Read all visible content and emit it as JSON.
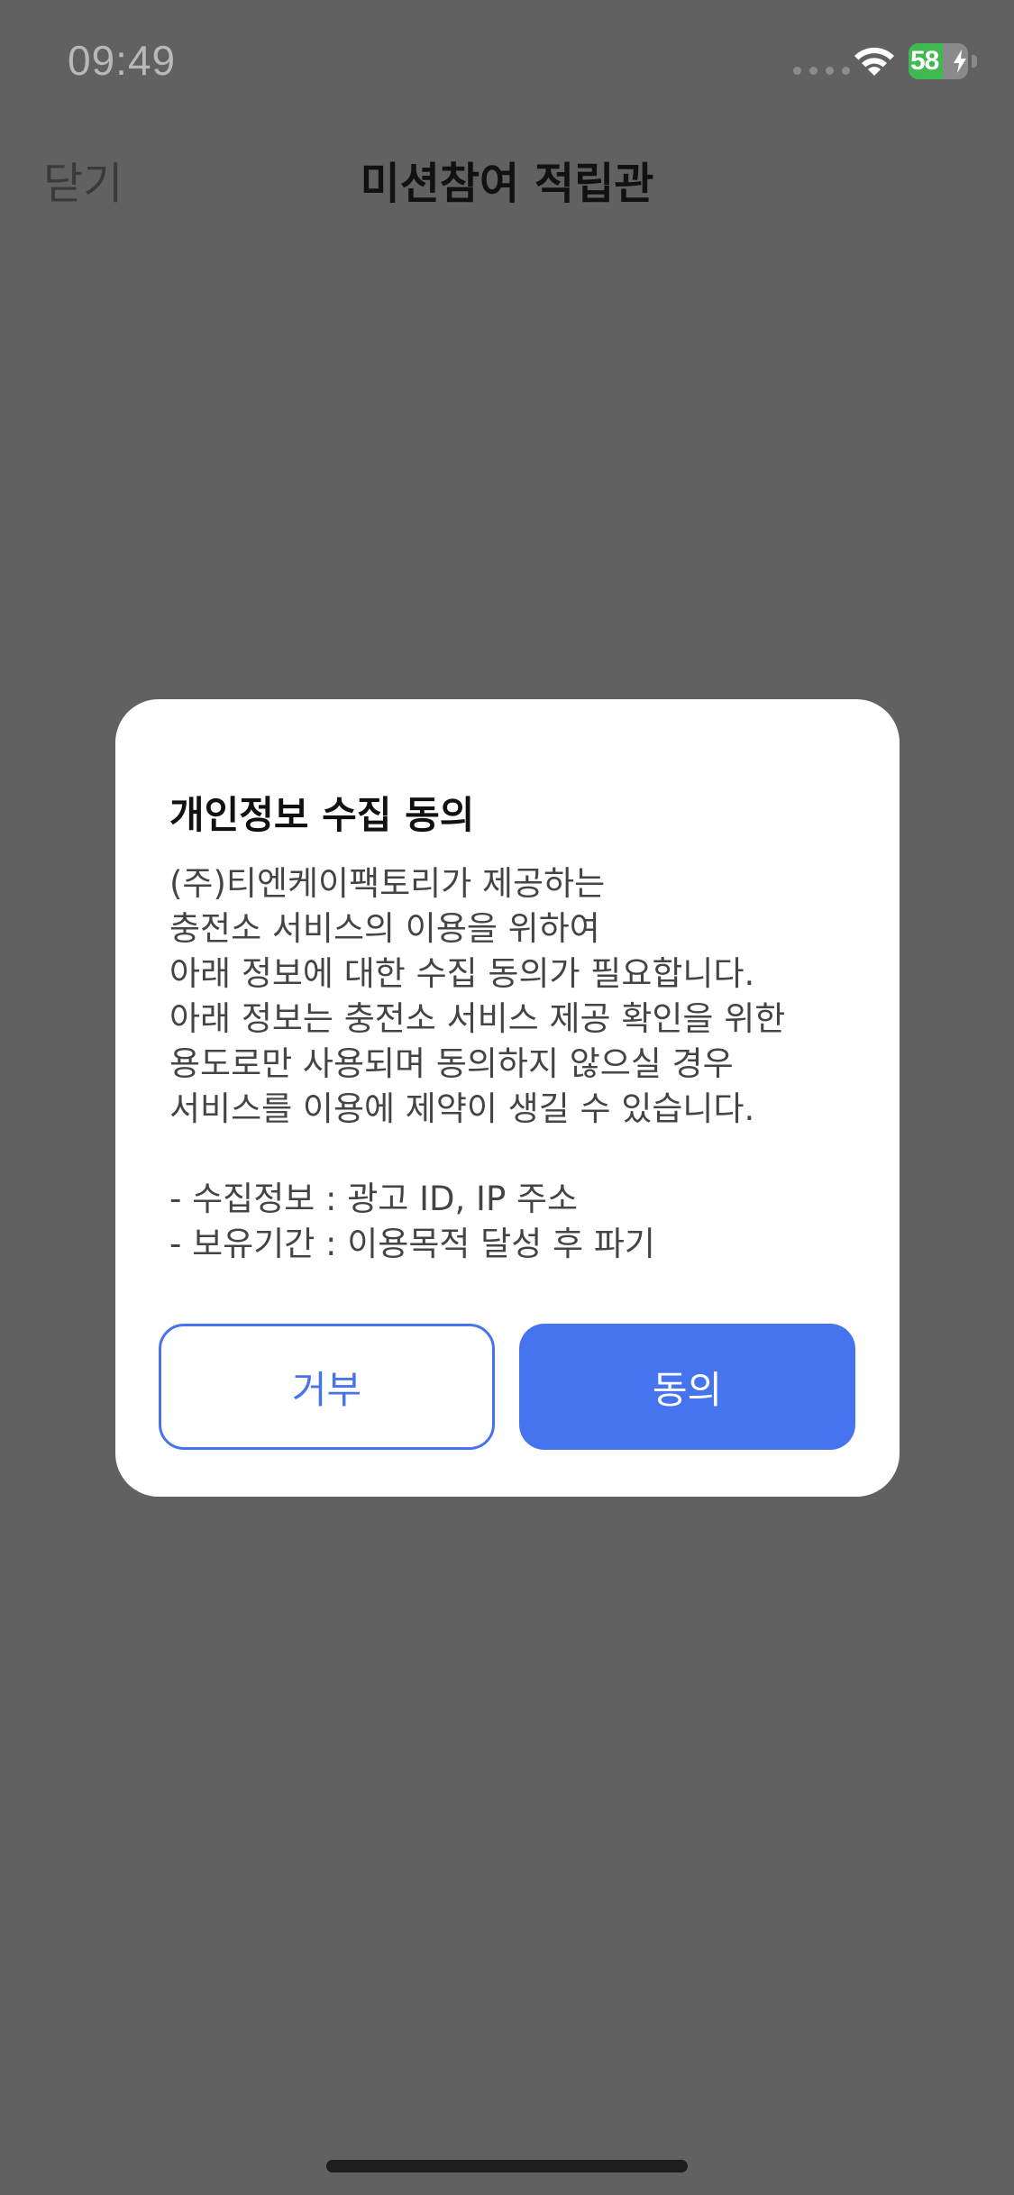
{
  "status_bar": {
    "time": "09:49",
    "battery_label": "58",
    "battery_level_percent": 58,
    "battery_color": "#3fb950",
    "icons": [
      "cellular-dots-icon",
      "wifi-icon",
      "battery-icon",
      "charging-bolt-icon"
    ]
  },
  "nav": {
    "close_label": "닫기",
    "title": "미션참여 적립관"
  },
  "modal": {
    "title": "개인정보 수집 동의",
    "body_lines": [
      "(주)티엔케이팩토리가 제공하는",
      "충전소 서비스의 이용을 위하여",
      "아래 정보에 대한 수집 동의가 필요합니다.",
      "아래 정보는 충전소 서비스 제공 확인을 위한",
      "용도로만 사용되며 동의하지 않으실 경우",
      "서비스를 이용에 제약이 생길 수 있습니다.",
      "",
      "- 수집정보 : 광고 ID, IP 주소",
      "- 보유기간 : 이용목적 달성 후 파기"
    ],
    "deny_label": "거부",
    "agree_label": "동의"
  },
  "colors": {
    "backdrop": "#616161",
    "accent": "#4574ee",
    "modal_background": "#ffffff"
  }
}
